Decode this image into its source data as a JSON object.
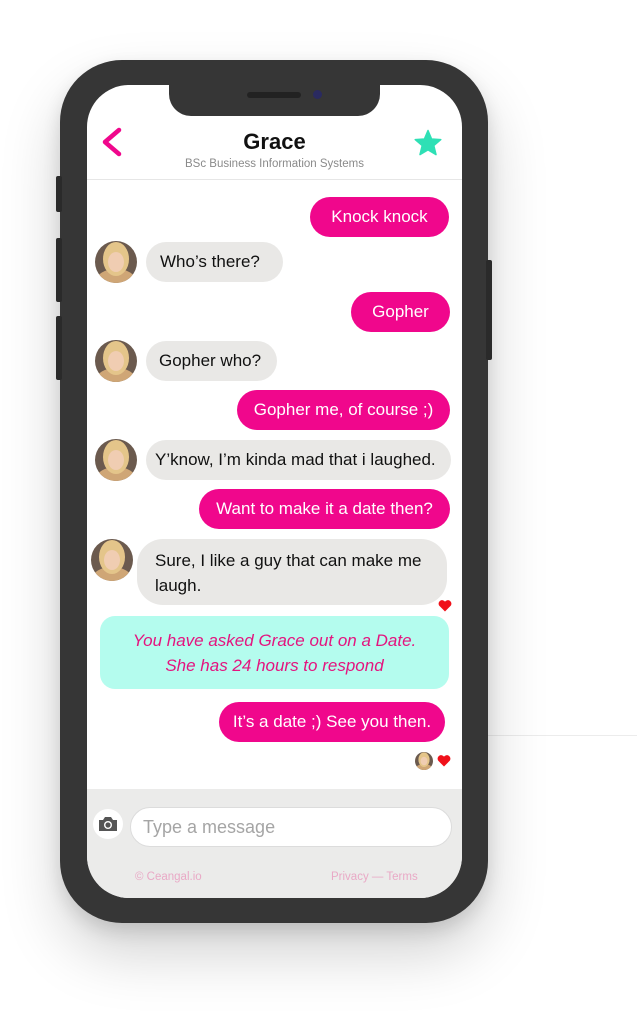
{
  "header": {
    "title": "Grace",
    "subtitle": "BSc Business Information Systems"
  },
  "messages": [
    {
      "from": "me",
      "text": "Knock knock"
    },
    {
      "from": "them",
      "text": "Who’s there?"
    },
    {
      "from": "me",
      "text": "Gopher"
    },
    {
      "from": "them",
      "text": "Gopher who?"
    },
    {
      "from": "me",
      "text": "Gopher me, of course ;)"
    },
    {
      "from": "them",
      "text": "Y’know, I’m kinda mad that i laughed."
    },
    {
      "from": "me",
      "text": "Want to make it a date then?"
    },
    {
      "from": "them",
      "line1": "Sure, I like a guy that can make me",
      "line2": "laugh.",
      "reaction": "heart-icon"
    },
    {
      "from": "me",
      "text": "It’s a date ;) See you then.",
      "reaction": "heart-icon"
    }
  ],
  "notice": {
    "line1": "You have asked Grace out on a Date.",
    "line2": "She has 24 hours to respond"
  },
  "composer": {
    "placeholder": "Type a message",
    "camera_icon": "camera-icon"
  },
  "footer": {
    "copyright": "© Ceangal.io",
    "privacy": "Privacy",
    "separator": " — ",
    "terms": "Terms"
  },
  "colors": {
    "accent_pink": "#f0078c",
    "star_teal": "#2ee0b5",
    "notice_bg": "#b4fcee",
    "incoming_bubble": "#e9e8e6",
    "heart_red": "#f0111a"
  }
}
